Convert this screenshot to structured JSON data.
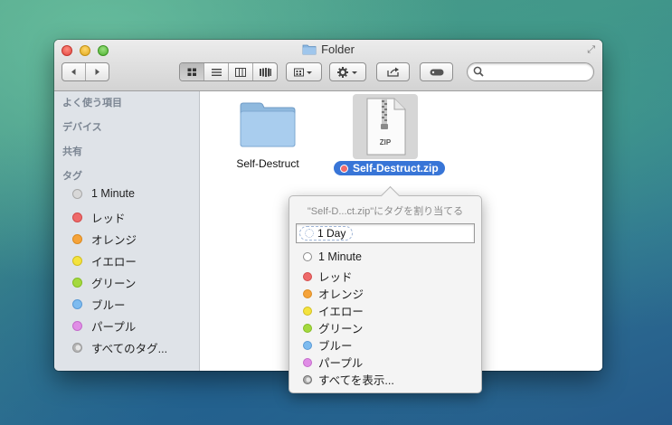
{
  "window": {
    "title": "Folder",
    "search_placeholder": ""
  },
  "toolbar": {
    "back_icon": "chevron-left-icon",
    "forward_icon": "chevron-right-icon",
    "view_modes": [
      "icon-view-icon",
      "list-view-icon",
      "column-view-icon",
      "coverflow-view-icon"
    ],
    "arrange_icon": "arrange-icon",
    "action_icon": "gear-icon",
    "share_icon": "share-icon",
    "tag_icon": "tag-icon"
  },
  "sidebar": {
    "sections": {
      "favorites": "よく使う項目",
      "devices": "デバイス",
      "shared": "共有",
      "tags": "タグ"
    },
    "tags": [
      {
        "label": "1 Minute",
        "color": "#d8d8d8",
        "border": "#a8a8a8"
      },
      {
        "label": "レッド",
        "color": "#ee6a6a",
        "border": "#d24a4a"
      },
      {
        "label": "オレンジ",
        "color": "#f5a33a",
        "border": "#db8a20"
      },
      {
        "label": "イエロー",
        "color": "#f4e33e",
        "border": "#d1be22"
      },
      {
        "label": "グリーン",
        "color": "#a4d93e",
        "border": "#86bd26"
      },
      {
        "label": "ブルー",
        "color": "#7dbbef",
        "border": "#5a9ad6"
      },
      {
        "label": "パープル",
        "color": "#e08de6",
        "border": "#c46bcb"
      },
      {
        "label": "すべてのタグ...",
        "color": "#c9c9c9",
        "border": "#9a9a9a"
      }
    ]
  },
  "files": [
    {
      "name": "Self-Destruct",
      "kind": "folder"
    },
    {
      "name": "Self-Destruct.zip",
      "kind": "zip",
      "badge": "ZIP",
      "tag_color": "#f06b6b"
    }
  ],
  "popover": {
    "title": "\"Self-D...ct.zip\"にタグを割り当てる",
    "token": "1 Day",
    "items": [
      {
        "label": "1 Minute",
        "color": "#ffffff",
        "border": "#8a8a8a"
      },
      {
        "label": "レッド",
        "color": "#ee6a6a",
        "border": "#d24a4a"
      },
      {
        "label": "オレンジ",
        "color": "#f5a33a",
        "border": "#db8a20"
      },
      {
        "label": "イエロー",
        "color": "#f4e33e",
        "border": "#d1be22"
      },
      {
        "label": "グリーン",
        "color": "#a4d93e",
        "border": "#86bd26"
      },
      {
        "label": "ブルー",
        "color": "#7dbbef",
        "border": "#5a9ad6"
      },
      {
        "label": "パープル",
        "color": "#e08de6",
        "border": "#c46bcb"
      },
      {
        "label": "すべてを表示...",
        "color": "#cfcfcf",
        "border": "#6f6f6f"
      }
    ]
  }
}
